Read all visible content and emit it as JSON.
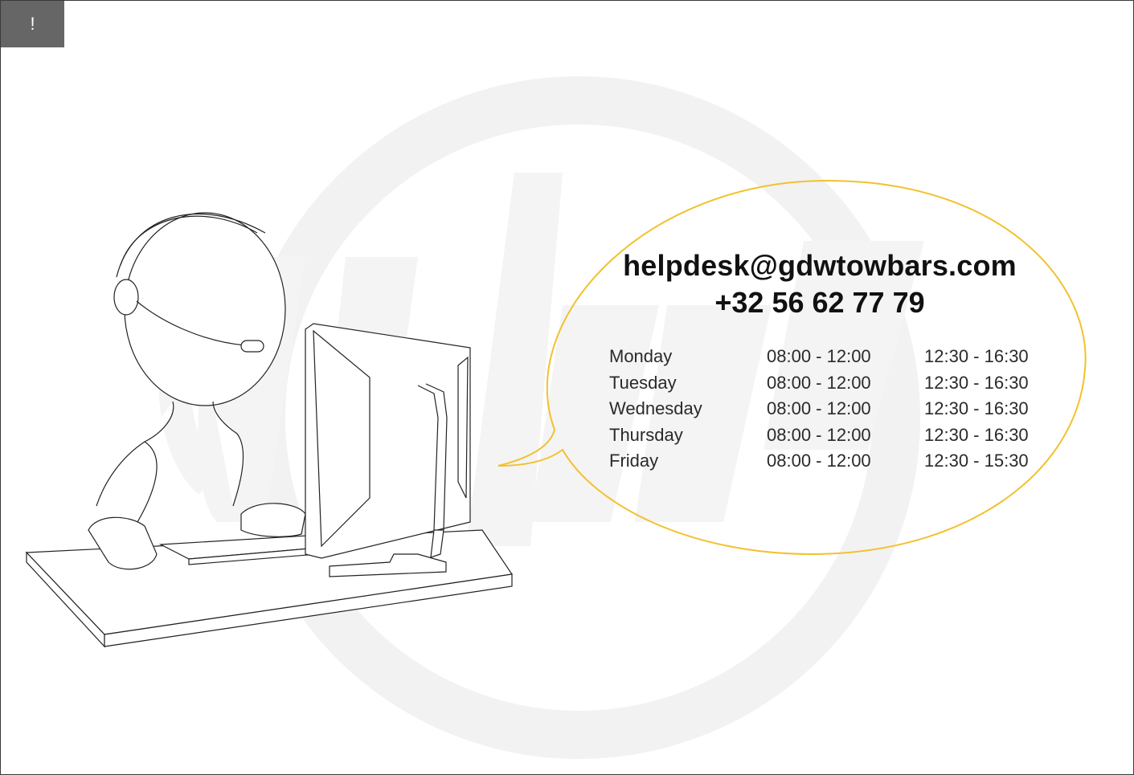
{
  "alert": {
    "icon": "exclamation-icon",
    "label": "!"
  },
  "contact": {
    "email": "helpdesk@gdwtowbars.com",
    "phone": "+32 56 62 77 79"
  },
  "hours": [
    {
      "day": "Monday",
      "morning": "08:00 - 12:00",
      "afternoon": "12:30 - 16:30"
    },
    {
      "day": "Tuesday",
      "morning": "08:00 - 12:00",
      "afternoon": "12:30 - 16:30"
    },
    {
      "day": "Wednesday",
      "morning": "08:00 - 12:00",
      "afternoon": "12:30 - 16:30"
    },
    {
      "day": "Thursday",
      "morning": "08:00 - 12:00",
      "afternoon": "12:30 - 16:30"
    },
    {
      "day": "Friday",
      "morning": "08:00 - 12:00",
      "afternoon": "12:30 - 15:30"
    }
  ],
  "colors": {
    "bubble_outline": "#F2C12E",
    "watermark": "#F2F2F2",
    "tab": "#666666",
    "line_art": "#222222"
  }
}
